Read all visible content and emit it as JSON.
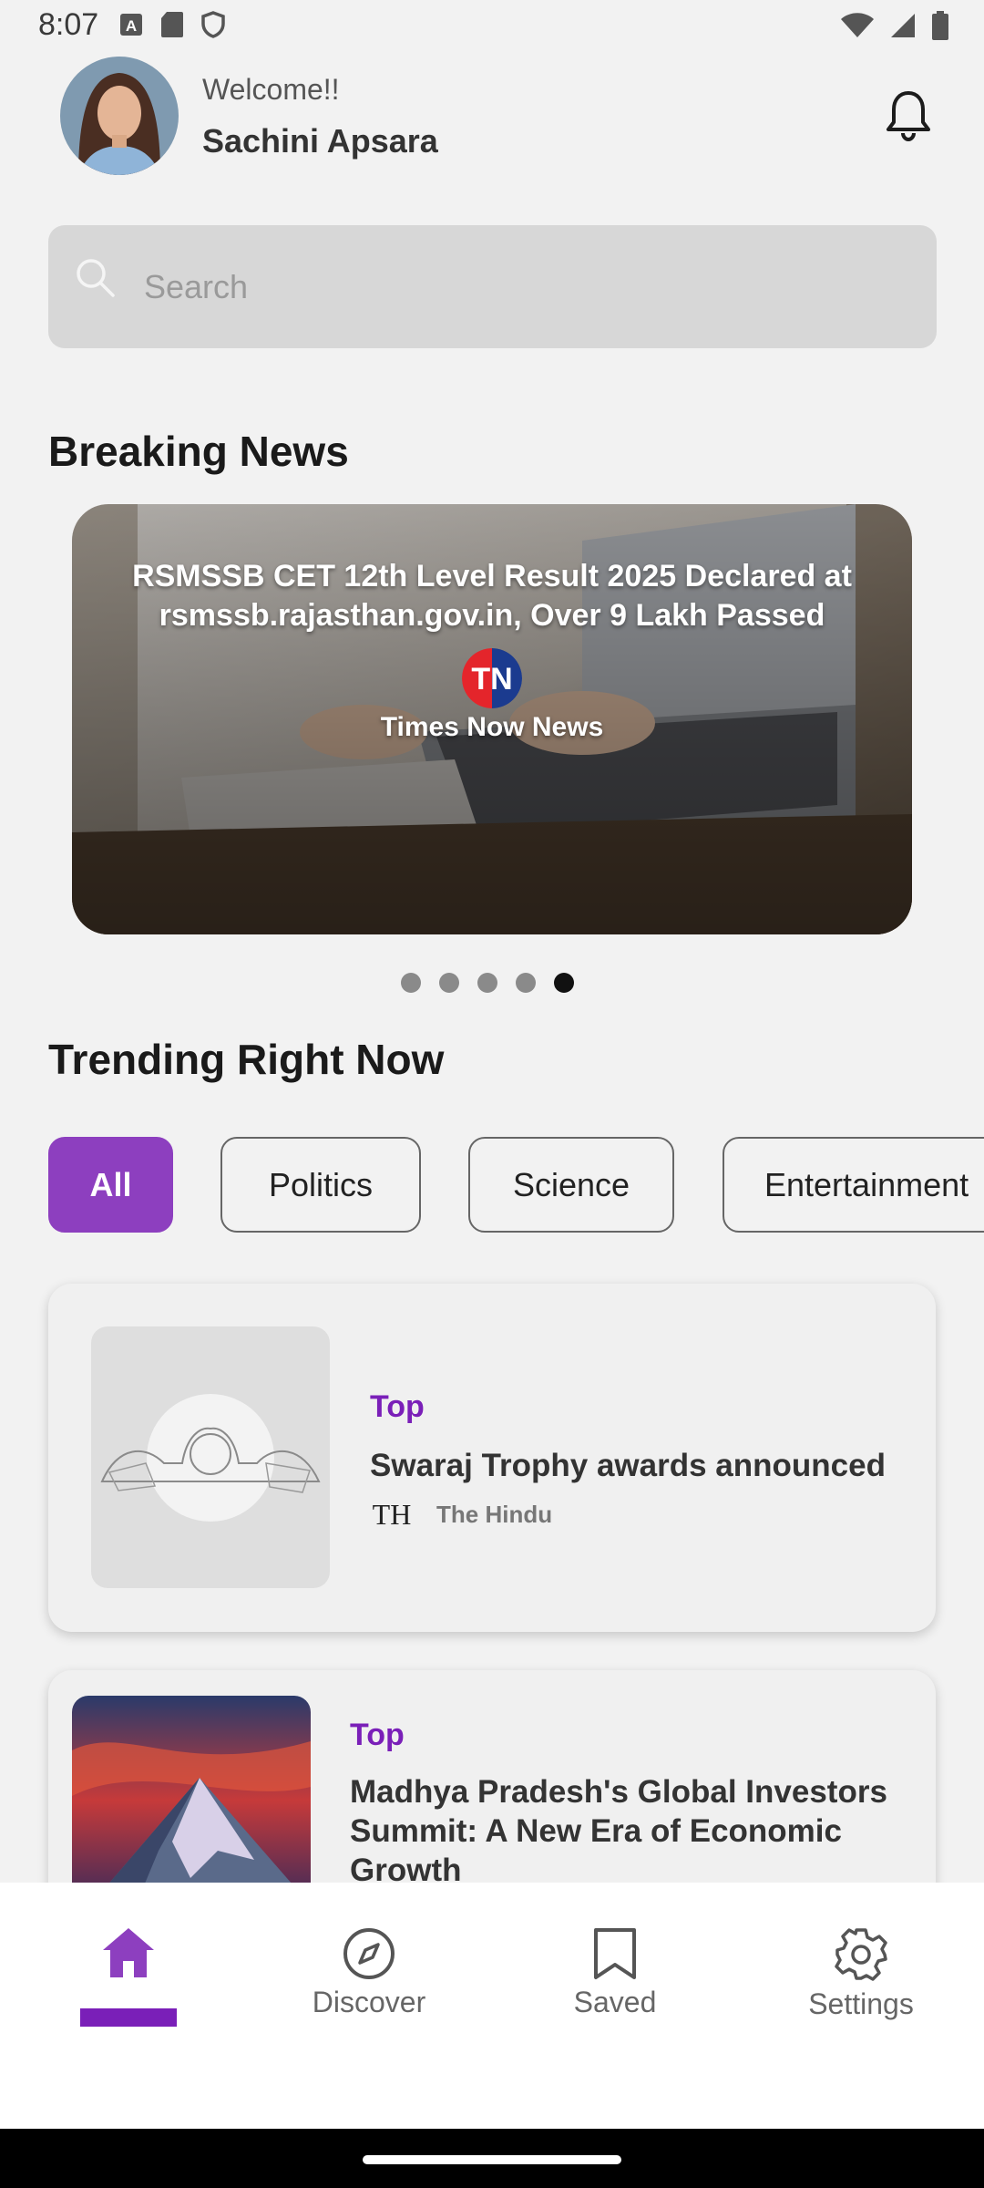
{
  "status_bar": {
    "time": "8:07"
  },
  "header": {
    "welcome": "Welcome!!",
    "username": "Sachini Apsara"
  },
  "search": {
    "placeholder": "Search"
  },
  "breaking_news": {
    "title": "Breaking News",
    "headline": "RSMSSB CET 12th Level Result 2025 Declared at rsmssb.rajasthan.gov.in, Over 9 Lakh Passed",
    "logo_text": "TN",
    "source": "Times Now News",
    "carousel": {
      "count": 5,
      "active_index": 5
    }
  },
  "trending": {
    "title": "Trending Right Now",
    "chips": [
      {
        "label": "All",
        "active": true
      },
      {
        "label": "Politics",
        "active": false
      },
      {
        "label": "Science",
        "active": false
      },
      {
        "label": "Entertainment",
        "active": false
      }
    ]
  },
  "articles": [
    {
      "category": "Top",
      "title": "Swaraj Trophy awards announced",
      "source": "The Hindu",
      "source_logo": "TH"
    },
    {
      "category": "Top",
      "title": "Madhya Pradesh's Global Investors Summit: A New Era of Economic Growth"
    }
  ],
  "bottom_nav": {
    "items": [
      {
        "label": "",
        "icon": "home-icon",
        "active": true
      },
      {
        "label": "Discover",
        "icon": "compass-icon",
        "active": false
      },
      {
        "label": "Saved",
        "icon": "bookmark-icon",
        "active": false
      },
      {
        "label": "Settings",
        "icon": "gear-icon",
        "active": false
      }
    ]
  },
  "colors": {
    "accent": "#8d3fbf",
    "category": "#7a1fb8",
    "search_bg": "#d7d7d7",
    "page_bg": "#f2f2f2"
  }
}
